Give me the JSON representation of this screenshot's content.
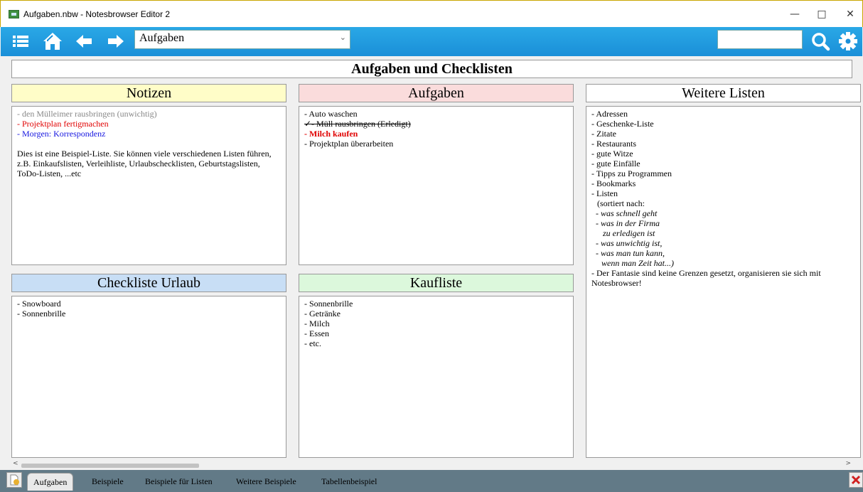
{
  "window": {
    "title": "Aufgaben.nbw - Notesbrowser Editor 2"
  },
  "toolbar": {
    "selected_page": "Aufgaben"
  },
  "page": {
    "heading": "Aufgaben und Checklisten"
  },
  "panels": {
    "notizen": {
      "title": "Notizen",
      "lines": [
        "- den Mülleimer rausbringen (unwichtig)",
        "- Projektplan fertigmachen",
        "- Morgen: Korrespondenz"
      ],
      "paragraph": "Dies ist eine Beispiel-Liste. Sie können viele verschiedenen Listen führen, z.B. Einkaufslisten, Verleihliste, Urlaubschecklisten, Geburtstagslisten, ToDo-Listen, ...etc",
      "color": "#fffdc8"
    },
    "aufgaben": {
      "title": "Aufgaben",
      "lines": [
        "- Auto waschen",
        "✓- Müll rausbringen (Erledigt)",
        "- Milch kaufen",
        "- Projektplan überarbeiten"
      ],
      "color": "#fadcdc"
    },
    "weitere": {
      "title": "Weitere Listen",
      "lines": [
        "- Adressen",
        "- Geschenke-Liste",
        "- Zitate",
        "- Restaurants",
        "- gute Witze",
        "- gute Einfälle",
        "- Tipps zu Programmen",
        "- Bookmarks",
        "-  Listen",
        "(sortiert nach:",
        "- was schnell geht",
        "- was in der Firma",
        "zu erledigen ist",
        "- was unwichtig ist,",
        "- was man tun kann,",
        "wenn man Zeit hat...)",
        "- Der Fantasie sind keine Grenzen gesetzt, organisieren sie sich mit Notesbrowser!"
      ],
      "color": "#ffffff"
    },
    "urlaub": {
      "title": "Checkliste Urlaub",
      "lines": [
        "- Snowboard",
        "- Sonnenbrille"
      ],
      "color": "#c8def5"
    },
    "kaufliste": {
      "title": "Kaufliste",
      "lines": [
        "- Sonnenbrille",
        "- Getränke",
        "- Milch",
        "- Essen",
        "- etc."
      ],
      "color": "#dcf8dc"
    }
  },
  "tabs": [
    "Aufgaben",
    "Beispiele",
    "Beispiele für Listen",
    "Weitere Beispiele",
    "Tabellenbeispiel"
  ],
  "colors": {
    "toolbar": "#1a9ae0",
    "tabbar": "#627a87",
    "alert_red": "#e00000",
    "link_blue": "#1515e0"
  },
  "icons": [
    "app-icon",
    "menu-icon",
    "home-icon",
    "back-arrow-icon",
    "forward-arrow-icon",
    "search-icon",
    "gear-icon",
    "new-page-icon",
    "close-page-icon"
  ]
}
